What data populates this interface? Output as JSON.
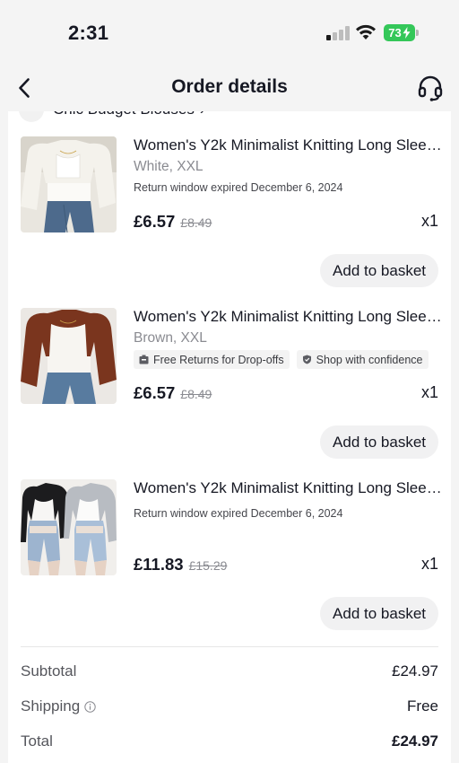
{
  "status_bar": {
    "time": "2:31",
    "battery": "73",
    "signal_icon": "cellular-signal-icon",
    "wifi_icon": "wifi-icon",
    "battery_color": "#34c759"
  },
  "header": {
    "title": "Order details",
    "back_icon": "chevron-left-icon",
    "support_icon": "headset-icon"
  },
  "shop": {
    "name": "Chic Budget Blouses",
    "chevron": "›"
  },
  "items": [
    {
      "title": "Women's Y2k Minimalist Knitting Long Sleeve...",
      "variant": "White, XXL",
      "note": "Return window expired December 6, 2024",
      "price": "£6.57",
      "original_price": "£8.49",
      "quantity": "x1",
      "button": "Add to basket"
    },
    {
      "title": "Women's Y2k Minimalist Knitting Long Sleeve...",
      "variant": "Brown, XXL",
      "tags": [
        {
          "label": "Free Returns for Drop-offs",
          "icon": "package-return-icon"
        },
        {
          "label": "Shop with confidence",
          "icon": "shield-icon"
        }
      ],
      "price": "£6.57",
      "original_price": "£8.49",
      "quantity": "x1",
      "button": "Add to basket"
    },
    {
      "title": "Women's Y2k Minimalist Knitting Long Sleeve...",
      "note": "Return window expired December 6, 2024",
      "price": "£11.83",
      "original_price": "£15.29",
      "quantity": "x1",
      "button": "Add to basket"
    }
  ],
  "summary": {
    "subtotal_label": "Subtotal",
    "subtotal_value": "£24.97",
    "shipping_label": "Shipping",
    "shipping_value": "Free",
    "total_label": "Total",
    "total_value": "£24.97"
  }
}
